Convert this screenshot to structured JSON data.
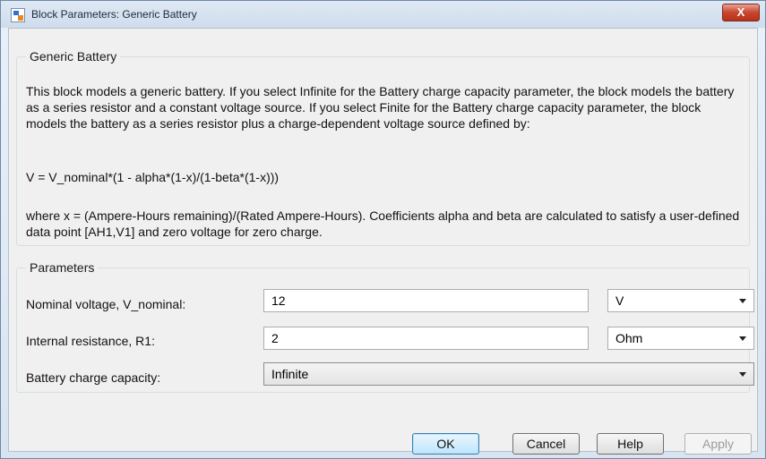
{
  "window": {
    "title": "Block Parameters: Generic Battery",
    "close_glyph": "X"
  },
  "description_group": {
    "legend": "Generic Battery",
    "paragraph1": "This block models a generic battery. If you select Infinite for the Battery charge capacity parameter, the block models the battery as a series resistor and a constant voltage source. If you select Finite for the Battery charge capacity parameter, the block models the battery as a series resistor plus a charge-dependent voltage source defined by:",
    "formula": "V = V_nominal*(1 - alpha*(1-x)/(1-beta*(1-x)))",
    "paragraph2": "where x = (Ampere-Hours remaining)/(Rated Ampere-Hours). Coefficients alpha and beta are calculated to satisfy a user-defined data point [AH1,V1] and zero voltage for zero charge."
  },
  "parameters_group": {
    "legend": "Parameters",
    "rows": [
      {
        "label": "Nominal voltage, V_nominal:",
        "value": "12",
        "unit": "V"
      },
      {
        "label": "Internal resistance, R1:",
        "value": "2",
        "unit": "Ohm"
      },
      {
        "label": "Battery charge capacity:",
        "value": "Infinite"
      }
    ]
  },
  "buttons": {
    "ok": "OK",
    "cancel": "Cancel",
    "help": "Help",
    "apply": "Apply"
  },
  "colors": {
    "title_close_button": "#c9452e",
    "default_button_border": "#3c7fb1",
    "window_frame": "#d9e4f1"
  },
  "icons": [
    "simulink-block-icon",
    "close-icon",
    "chevron-down-icon"
  ]
}
